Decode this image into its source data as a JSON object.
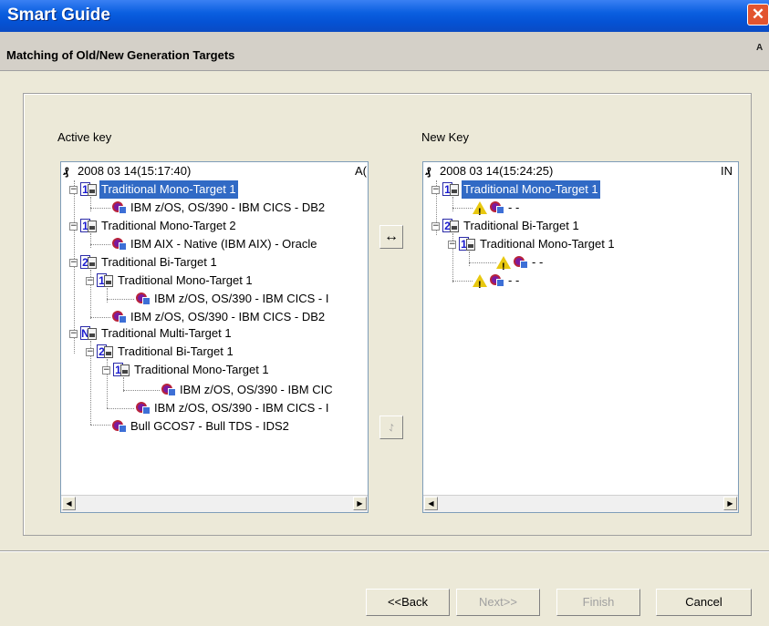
{
  "window": {
    "title": "Smart Guide",
    "close_glyph": "✕"
  },
  "header": {
    "subtitle": "Matching of Old/New Generation Targets"
  },
  "left": {
    "label": "Active key",
    "root": "2008 03 14(15:17:40)",
    "root_tail": "A(",
    "nodes": [
      "Traditional Mono-Target 1",
      "IBM z/OS, OS/390 - IBM CICS - DB2",
      "Traditional Mono-Target 2",
      "IBM AIX - Native (IBM AIX) - Oracle",
      "Traditional Bi-Target 1",
      "Traditional Mono-Target 1",
      "IBM z/OS, OS/390 - IBM CICS - I",
      "IBM z/OS, OS/390 - IBM CICS - DB2",
      "Traditional Multi-Target 1",
      "Traditional Bi-Target 1",
      "Traditional Mono-Target 1",
      "IBM z/OS, OS/390 - IBM CIC",
      "IBM z/OS, OS/390 - IBM CICS - I",
      "Bull GCOS7 - Bull TDS - IDS2"
    ],
    "badges": {
      "mono": "1",
      "bi": "2",
      "multi": "N"
    }
  },
  "right": {
    "label": "New Key",
    "root": "2008 03 14(15:24:25)",
    "root_tail": "IN",
    "nodes": [
      "Traditional Mono-Target 1",
      "- -",
      "Traditional Bi-Target 1",
      "Traditional Mono-Target 1",
      "- -",
      "- -"
    ]
  },
  "middle": {
    "match_glyph": "↔",
    "auto_glyph": "⥌"
  },
  "buttons": {
    "back": "<<Back",
    "next": "Next>>",
    "finish": "Finish",
    "cancel": "Cancel"
  },
  "colors": {
    "selection": "#316ac5",
    "titlebar": "#0a5fe0"
  }
}
